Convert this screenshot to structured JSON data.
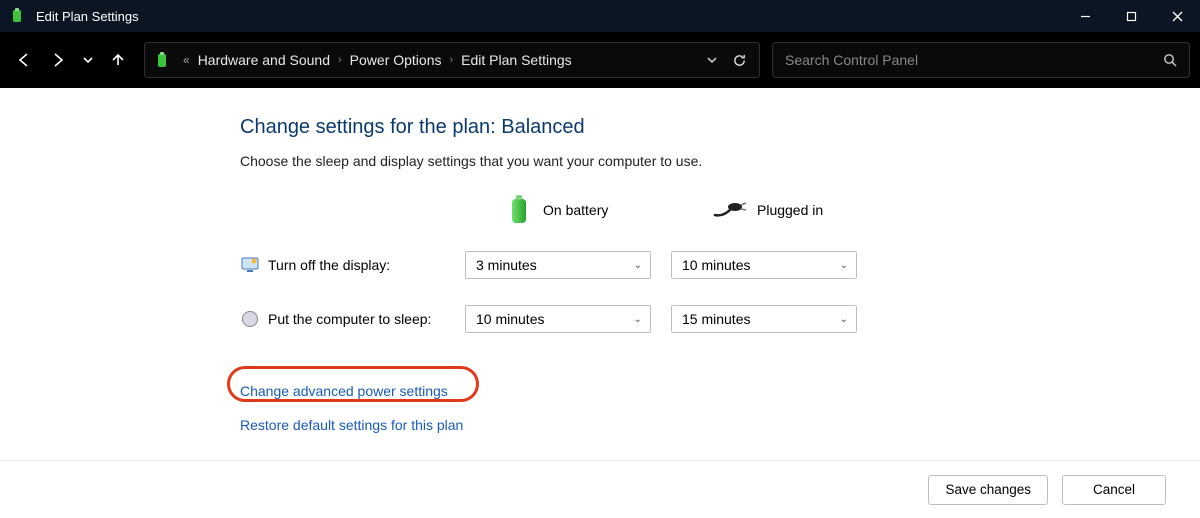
{
  "window": {
    "title": "Edit Plan Settings"
  },
  "breadcrumb": {
    "prefix": "«",
    "items": [
      "Hardware and Sound",
      "Power Options",
      "Edit Plan Settings"
    ]
  },
  "search": {
    "placeholder": "Search Control Panel"
  },
  "page": {
    "heading": "Change settings for the plan: Balanced",
    "subtitle": "Choose the sleep and display settings that you want your computer to use.",
    "col_battery": "On battery",
    "col_plugged": "Plugged in",
    "rows": {
      "display": {
        "label": "Turn off the display:",
        "battery": "3 minutes",
        "plugged": "10 minutes"
      },
      "sleep": {
        "label": "Put the computer to sleep:",
        "battery": "10 minutes",
        "plugged": "15 minutes"
      }
    },
    "link_advanced": "Change advanced power settings",
    "link_restore": "Restore default settings for this plan"
  },
  "footer": {
    "save": "Save changes",
    "cancel": "Cancel"
  }
}
